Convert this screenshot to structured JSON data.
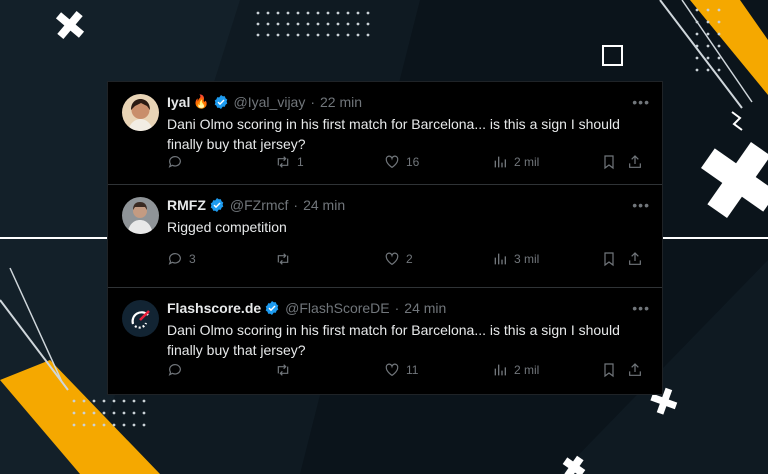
{
  "tweets": [
    {
      "name": "Iyal",
      "emoji": "🔥",
      "handle": "@Iyal_vijay",
      "time": "22 min",
      "text": "Dani Olmo scoring in his first match for Barcelona... is this a sign I should finally buy that jersey?",
      "replies": "",
      "retweets": "1",
      "likes": "16",
      "views": "2 mil"
    },
    {
      "name": "RMFZ",
      "emoji": "",
      "handle": "@FZrmcf",
      "time": "24 min",
      "text": "Rigged competition",
      "replies": "3",
      "retweets": "",
      "likes": "2",
      "views": "3 mil"
    },
    {
      "name": "Flashscore.de",
      "emoji": "",
      "handle": "@FlashScoreDE",
      "time": "24 min",
      "text": "Dani Olmo scoring in his first match for Barcelona... is this a sign I should finally buy that jersey?",
      "replies": "",
      "retweets": "",
      "likes": "11",
      "views": "2 mil"
    }
  ],
  "colors": {
    "accent": "#f5a800",
    "verified": "#1d9bf0",
    "background": "#0f1a22"
  }
}
